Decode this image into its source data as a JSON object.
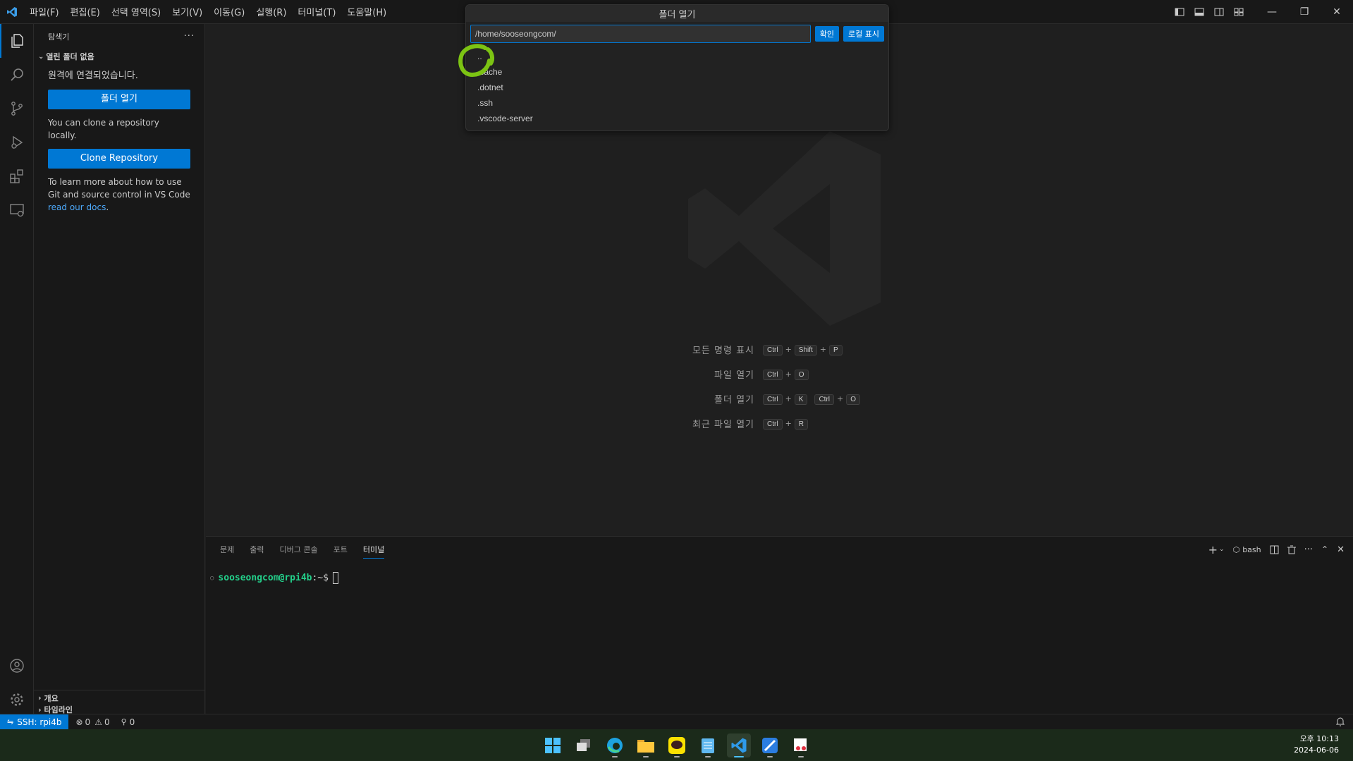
{
  "titlebar": {
    "menus": [
      "파일(F)",
      "편집(E)",
      "선택 영역(S)",
      "보기(V)",
      "이동(G)",
      "실행(R)",
      "터미널(T)",
      "도움말(H)"
    ],
    "window_controls": {
      "minimize": "—",
      "restore": "❐",
      "close": "✕"
    }
  },
  "quick_pick": {
    "title": "폴더 열기",
    "input_value": "/home/sooseongcom/",
    "ok_label": "확인",
    "local_label": "로컬 표시",
    "items": [
      "..",
      ".cache",
      ".dotnet",
      ".ssh",
      ".vscode-server"
    ]
  },
  "sidebar": {
    "header": "탐색기",
    "more": "···",
    "section_title": "열린 폴더 없음",
    "connected_text": "원격에 연결되었습니다.",
    "open_folder_button": "폴더 열기",
    "clone_text": "You can clone a repository locally.",
    "clone_button": "Clone Repository",
    "learn_text": "To learn more about how to use Git and source control in VS Code ",
    "learn_link": "read our docs",
    "learn_end": ".",
    "outline": "개요",
    "timeline": "타임라인"
  },
  "editor": {
    "shortcuts": [
      {
        "label": "모든 명령 표시",
        "keys": [
          [
            "Ctrl",
            "Shift",
            "P"
          ]
        ]
      },
      {
        "label": "파일 열기",
        "keys": [
          [
            "Ctrl",
            "O"
          ]
        ]
      },
      {
        "label": "폴더 열기",
        "keys": [
          [
            "Ctrl",
            "K"
          ],
          [
            "Ctrl",
            "O"
          ]
        ]
      },
      {
        "label": "최근 파일 열기",
        "keys": [
          [
            "Ctrl",
            "R"
          ]
        ]
      }
    ]
  },
  "panel": {
    "tabs": [
      "문제",
      "출력",
      "디버그 콘솔",
      "포트",
      "터미널"
    ],
    "active_tab": "터미널",
    "terminal_name": "bash",
    "prompt_user": "sooseongcom@rpi4b",
    "prompt_suffix": ":~$"
  },
  "statusbar": {
    "remote": "SSH: rpi4b",
    "errors": "0",
    "warnings": "0",
    "ports": "0"
  },
  "taskbar": {
    "time": "오후 10:13",
    "date": "2024-06-06"
  },
  "colors": {
    "accent": "#0078d4",
    "prompt_green": "#23d18b",
    "highlight": "#7cc313"
  }
}
